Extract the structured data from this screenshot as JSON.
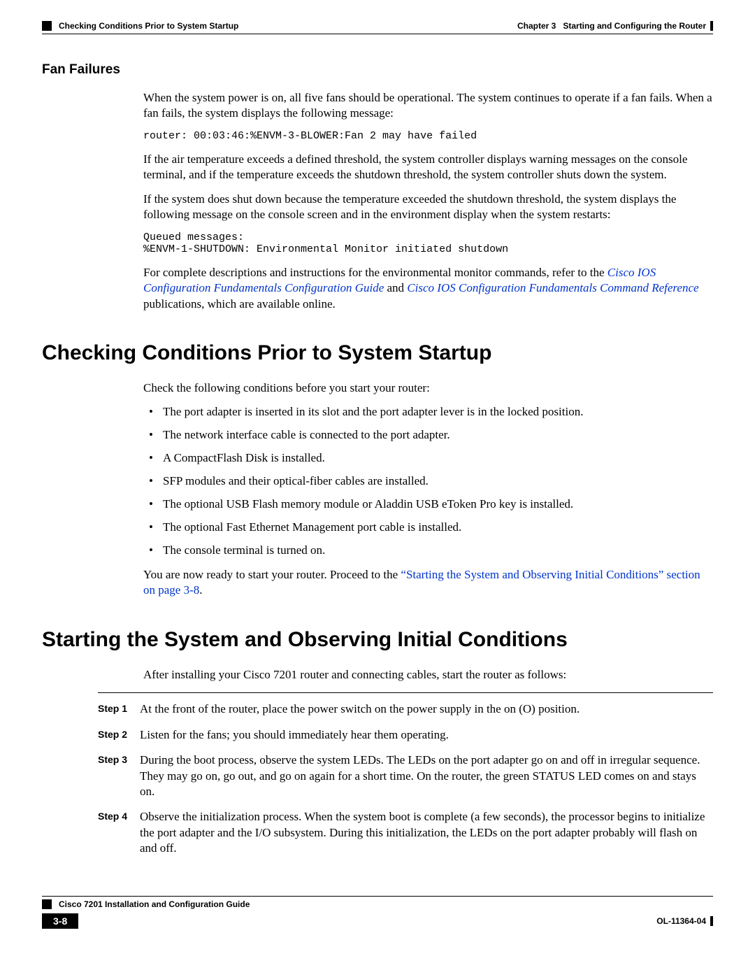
{
  "header": {
    "left": "Checking Conditions Prior to System Startup",
    "right_chapter": "Chapter 3",
    "right_title": "Starting and Configuring the Router"
  },
  "fan": {
    "heading": "Fan Failures",
    "p1": "When the system power is on, all five fans should be operational. The system continues to operate if a fan fails. When a fan fails, the system displays the following message:",
    "code1": "router: 00:03:46:%ENVM-3-BLOWER:Fan 2 may have failed",
    "p2": "If the air temperature exceeds a defined threshold, the system controller displays warning messages on the console terminal, and if the temperature exceeds the shutdown threshold, the system controller shuts down the system.",
    "p3": "If the system does shut down because the temperature exceeded the shutdown threshold, the system displays the following message on the console screen and in the environment display when the system restarts:",
    "code2": "Queued messages:\n%ENVM-1-SHUTDOWN: Environmental Monitor initiated shutdown",
    "p4_a": "For complete descriptions and instructions for the environmental monitor commands, refer to the ",
    "link1": "Cisco IOS Configuration Fundamentals Configuration Guide",
    "p4_b": " and ",
    "link2": "Cisco IOS Configuration Fundamentals Command Reference",
    "p4_c": " publications, which are available online."
  },
  "check": {
    "heading": "Checking Conditions Prior to System Startup",
    "intro": "Check the following conditions before you start your router:",
    "bullets": [
      "The port adapter is inserted in its slot and the port adapter lever is in the locked position.",
      "The network interface cable is connected to the port adapter.",
      "A CompactFlash Disk is installed.",
      "SFP modules and their optical-fiber cables are installed.",
      "The optional USB Flash memory module or Aladdin USB eToken Pro key is installed.",
      "The optional Fast Ethernet Management port cable is installed.",
      "The console terminal is turned on."
    ],
    "outro_a": "You are now ready to start your router. Proceed to the ",
    "outro_link": "“Starting the System and Observing Initial Conditions” section on page 3-8",
    "outro_b": "."
  },
  "start": {
    "heading": "Starting the System and Observing Initial Conditions",
    "intro": "After installing your Cisco 7201 router and connecting cables, start the router as follows:",
    "steps": [
      {
        "label": "Step 1",
        "text": "At the front of the router, place the power switch on the power supply in the on (O) position."
      },
      {
        "label": "Step 2",
        "text": "Listen for the fans; you should immediately hear them operating."
      },
      {
        "label": "Step 3",
        "text": "During the boot process, observe the system LEDs. The LEDs on the port adapter go on and off in irregular sequence. They may go on, go out, and go on again for a short time. On the router, the green STATUS LED comes on and stays on."
      },
      {
        "label": "Step 4",
        "text": "Observe the initialization process. When the system boot is complete (a few seconds), the processor begins to initialize the port adapter and the I/O subsystem. During this initialization, the LEDs on the port adapter probably will flash on and off."
      }
    ]
  },
  "footer": {
    "title": "Cisco 7201 Installation and Configuration Guide",
    "page": "3-8",
    "docid": "OL-11364-04"
  }
}
